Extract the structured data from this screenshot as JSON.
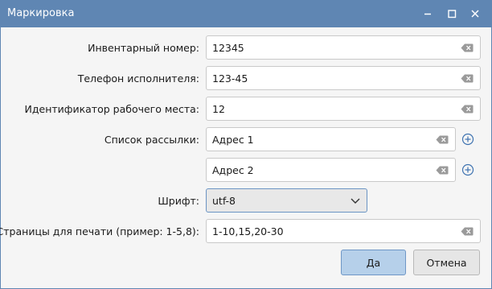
{
  "window": {
    "title": "Маркировка",
    "accent_color": "#5f86b3",
    "controls": {
      "minimize_icon": "minimize-icon",
      "maximize_icon": "maximize-icon",
      "close_icon": "close-icon"
    }
  },
  "form": {
    "inventory": {
      "label": "Инвентарный номер:",
      "value": "12345"
    },
    "phone": {
      "label": "Телефон исполнителя:",
      "value": "123-45"
    },
    "workplace": {
      "label": "Идентификатор рабочего места:",
      "value": "12"
    },
    "mailing": {
      "label": "Список рассылки:",
      "addresses": [
        "Адрес 1",
        "Адрес 2"
      ]
    },
    "font": {
      "label": "Шрифт:",
      "value": "utf-8"
    },
    "pages": {
      "label": "Страницы для печати (пример: 1-5,8):",
      "value": "1-10,15,20-30"
    }
  },
  "buttons": {
    "ok_label": "Да",
    "cancel_label": "Отмена"
  }
}
